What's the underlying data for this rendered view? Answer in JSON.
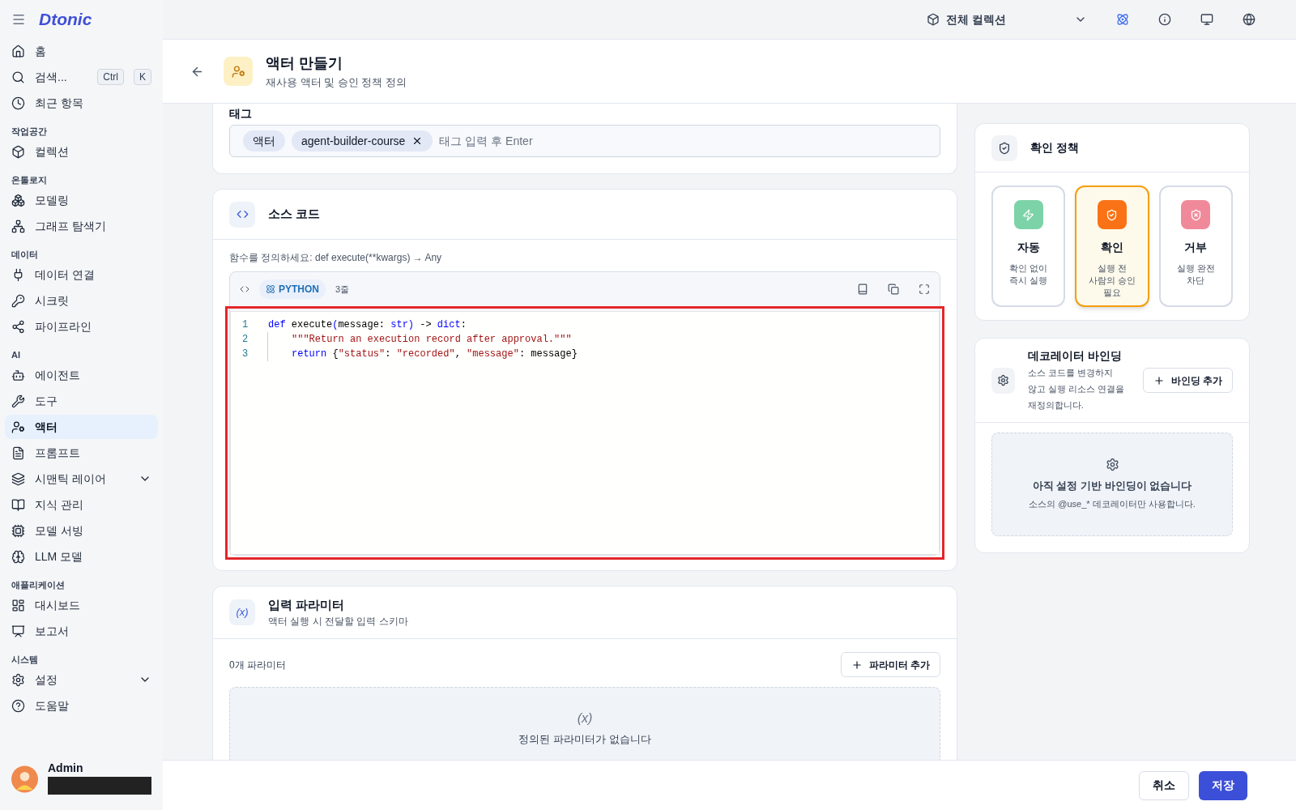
{
  "brand": "Dtonic",
  "topbar": {
    "collection": "전체 컬렉션"
  },
  "sidebar": {
    "top": [
      {
        "label": "홈",
        "selected": false,
        "kind": "link"
      },
      {
        "label": "검색...",
        "selected": false,
        "kind": "search",
        "keys": [
          "Ctrl",
          "K"
        ]
      },
      {
        "label": "최근 항목",
        "selected": false,
        "kind": "link"
      }
    ],
    "sections": [
      {
        "title": "작업공간",
        "items": [
          {
            "label": "컬렉션",
            "selected": false,
            "kind": "link"
          }
        ]
      },
      {
        "title": "온톨로지",
        "items": [
          {
            "label": "모델링",
            "selected": false,
            "kind": "link"
          },
          {
            "label": "그래프 탐색기",
            "selected": false,
            "kind": "link"
          }
        ]
      },
      {
        "title": "데이터",
        "items": [
          {
            "label": "데이터 연결",
            "selected": false,
            "kind": "link"
          },
          {
            "label": "시크릿",
            "selected": false,
            "kind": "link"
          },
          {
            "label": "파이프라인",
            "selected": false,
            "kind": "link"
          }
        ]
      },
      {
        "title": "AI",
        "items": [
          {
            "label": "에이전트",
            "selected": false,
            "kind": "link"
          },
          {
            "label": "도구",
            "selected": false,
            "kind": "link"
          },
          {
            "label": "액터",
            "selected": true,
            "kind": "link"
          },
          {
            "label": "프롬프트",
            "selected": false,
            "kind": "link"
          },
          {
            "label": "시맨틱 레이어",
            "selected": false,
            "kind": "group"
          },
          {
            "label": "지식 관리",
            "selected": false,
            "kind": "link"
          },
          {
            "label": "모델 서빙",
            "selected": false,
            "kind": "link"
          },
          {
            "label": "LLM 모델",
            "selected": false,
            "kind": "link"
          }
        ]
      },
      {
        "title": "애플리케이션",
        "items": [
          {
            "label": "대시보드",
            "selected": false,
            "kind": "link"
          },
          {
            "label": "보고서",
            "selected": false,
            "kind": "link"
          }
        ]
      },
      {
        "title": "시스템",
        "items": [
          {
            "label": "설정",
            "selected": false,
            "kind": "group"
          },
          {
            "label": "도움말",
            "selected": false,
            "kind": "link"
          }
        ]
      }
    ],
    "user": {
      "name": "Admin"
    }
  },
  "header": {
    "title": "액터 만들기",
    "subtitle": "재사용 액터 및 승인 정책 정의"
  },
  "tags": {
    "label": "태그",
    "items": [
      {
        "label": "액터",
        "removable": false
      },
      {
        "label": "agent-builder-course",
        "removable": true
      }
    ],
    "placeholder": "태그 입력 후 Enter"
  },
  "source": {
    "title": "소스 코드",
    "hint": "함수를 정의하세요: def execute(**kwargs) → Any",
    "language": "PYTHON",
    "line_count": "3줄",
    "lines": [
      {
        "number": "1",
        "indented": false,
        "tokens": [
          {
            "kind": "keyword",
            "text": "def"
          },
          {
            "kind": "plain",
            "text": " execute"
          },
          {
            "kind": "keyword",
            "text": "("
          },
          {
            "kind": "plain",
            "text": "message: "
          },
          {
            "kind": "keyword",
            "text": "str"
          },
          {
            "kind": "keyword",
            "text": ")"
          },
          {
            "kind": "plain",
            "text": " -> "
          },
          {
            "kind": "keyword",
            "text": "dict"
          },
          {
            "kind": "plain",
            "text": ":"
          }
        ]
      },
      {
        "number": "2",
        "indented": true,
        "tokens": [
          {
            "kind": "string",
            "text": "\"\"\"Return an execution record after approval.\"\"\""
          }
        ]
      },
      {
        "number": "3",
        "indented": true,
        "tokens": [
          {
            "kind": "keyword",
            "text": "return"
          },
          {
            "kind": "plain",
            "text": " {"
          },
          {
            "kind": "string",
            "text": "\"status\""
          },
          {
            "kind": "plain",
            "text": ": "
          },
          {
            "kind": "string",
            "text": "\"recorded\""
          },
          {
            "kind": "plain",
            "text": ", "
          },
          {
            "kind": "string",
            "text": "\"message\""
          },
          {
            "kind": "plain",
            "text": ": message}"
          }
        ]
      }
    ]
  },
  "params": {
    "icon_symbol": "(x)",
    "title": "입력 파라미터",
    "subtitle": "액터 실행 시 전달할 입력 스키마",
    "count": "0개 파라미터",
    "add_button": "파라미터 추가",
    "empty_symbol": "(x)",
    "empty_text": "정의된 파라미터가 없습니다"
  },
  "policy": {
    "title": "확인 정책",
    "options": [
      {
        "kind": "auto",
        "label": "자동",
        "description": "확인 없이 즉시 실행",
        "selected": false,
        "color": "#7dd3a8"
      },
      {
        "kind": "confirm",
        "label": "확인",
        "description": "실행 전 사람의 승인 필요",
        "selected": true,
        "color": "#f97316"
      },
      {
        "kind": "deny",
        "label": "거부",
        "description": "실행 완전 차단",
        "selected": false,
        "color": "#f08a9a"
      }
    ]
  },
  "bindings": {
    "title": "데코레이터 바인딩",
    "description": "소스 코드를 변경하지 않고 실행 리소스 연결을 재정의합니다.",
    "add_button": "바인딩 추가",
    "empty_title": "아직 설정 기반 바인딩이 없습니다",
    "empty_text": "소스의 @use_* 데코레이터만 사용합니다."
  },
  "footer": {
    "cancel": "취소",
    "save": "저장"
  }
}
